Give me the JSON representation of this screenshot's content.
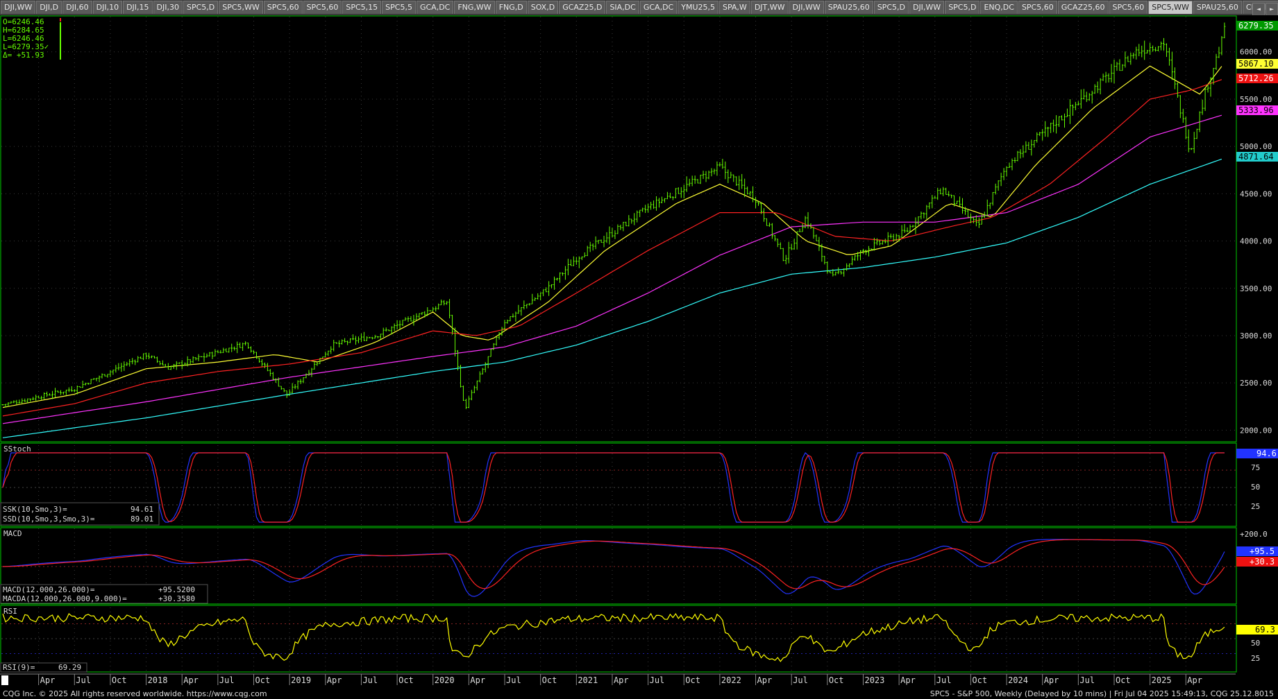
{
  "tabs": [
    {
      "label": "DJI,WW"
    },
    {
      "label": "DJI,D"
    },
    {
      "label": "DJI,60"
    },
    {
      "label": "DJI,10"
    },
    {
      "label": "DJI,15"
    },
    {
      "label": "DJI,30"
    },
    {
      "label": "SPC5,D"
    },
    {
      "label": "SPC5,WW"
    },
    {
      "label": "SPC5,60"
    },
    {
      "label": "SPC5,60"
    },
    {
      "label": "SPC5,15"
    },
    {
      "label": "SPC5,5"
    },
    {
      "label": "GCA,DC"
    },
    {
      "label": "FNG,WW"
    },
    {
      "label": "FNG,D"
    },
    {
      "label": "SOX,D"
    },
    {
      "label": "GCAZ25,D"
    },
    {
      "label": "SIA,DC"
    },
    {
      "label": "GCA,DC"
    },
    {
      "label": "YMU25,5"
    },
    {
      "label": "SPA,W"
    },
    {
      "label": "DJT,WW"
    },
    {
      "label": "DJI,WW"
    },
    {
      "label": "SPAU25,60"
    },
    {
      "label": "SPC5,D"
    },
    {
      "label": "DJI,WW"
    },
    {
      "label": "SPC5,D"
    },
    {
      "label": "ENQ,DC"
    },
    {
      "label": "SPC5,60"
    },
    {
      "label": "GCAZ25,60"
    },
    {
      "label": "SPC5,60"
    },
    {
      "label": "SPC5,WW",
      "active": true
    },
    {
      "label": "SPAU25,60"
    },
    {
      "label": "CNA,DC"
    },
    {
      "label": "+"
    }
  ],
  "nav": {
    "left": "◄",
    "right": "►"
  },
  "ohlc": {
    "open": "O=6246.46",
    "high": "H=6284.65",
    "low": "L=6246.46",
    "last": "L=6279.35✓",
    "delta": "Δ= +51.93"
  },
  "colors": {
    "bars": "#66ff00",
    "ma1": "#ffff33",
    "ma2": "#ff2222",
    "ma3": "#ff33ff",
    "ma4": "#33ffff",
    "k": "#2233ff",
    "d": "#ff2222",
    "rsi": "#ffff00",
    "grid": "#3a3a3a",
    "border": "#00cc00"
  },
  "price_axis": {
    "ticks": [
      "6000.00",
      "5500.00",
      "5000.00",
      "4500.00",
      "4000.00",
      "3500.00",
      "3000.00",
      "2500.00",
      "2000.00"
    ]
  },
  "badges": {
    "last": "6279.35",
    "ma1": "5867.10",
    "ma2": "5712.26",
    "ma3": "5333.96",
    "ma4": "4871.64"
  },
  "sstoch": {
    "title": "SStoch",
    "ssk_label": "SSK(10,Smo,3)=",
    "ssk_value": "94.61",
    "ssd_label": "SSD(10,Smo,3,Smo,3)=",
    "ssd_value": "89.01",
    "axis": [
      "75",
      "50",
      "25"
    ],
    "badge": "94.6"
  },
  "macd": {
    "title": "MACD",
    "macd_label": "MACD(12.000,26.000)=",
    "macd_value": "+95.5200",
    "macda_label": "MACDA(12.000,26.000,9.000)=",
    "macda_value": "+30.3580",
    "axis": [
      "+200.0"
    ],
    "badge1": "+95.5",
    "badge2": "+30.3"
  },
  "rsi": {
    "title": "RSI",
    "label": "RSI(9)=",
    "value": "69.29",
    "axis": [
      "50",
      "25"
    ],
    "badge": "69.3"
  },
  "time_axis": {
    "labels": [
      "Apr",
      "Jul",
      "Oct",
      "2018",
      "Apr",
      "Jul",
      "Oct",
      "2019",
      "Apr",
      "Jul",
      "Oct",
      "2020",
      "Apr",
      "Jul",
      "Oct",
      "2021",
      "Apr",
      "Jul",
      "Oct",
      "2022",
      "Apr",
      "Jul",
      "Oct",
      "2023",
      "Apr",
      "Jul",
      "Oct",
      "2024",
      "Apr",
      "Jul",
      "Oct",
      "2025",
      "Apr"
    ]
  },
  "footer": {
    "left": "CQG Inc. © 2025 All rights reserved worldwide. https://www.cqg.com",
    "right": "SPC5 - S&P 500, Weekly (Delayed by 10 mins) | Fri Jul 04 2025 15:49:13, CQG 25.12.8015"
  },
  "chart_data": {
    "type": "line",
    "title": "",
    "x_start": "2017-01-06",
    "x_end": "2025-07-04",
    "ylim": [
      1900,
      6350
    ],
    "series": [
      {
        "values": [
          [
            2017.0,
            2270
          ],
          [
            2017.5,
            2440
          ],
          [
            2018.0,
            2800
          ],
          [
            2018.15,
            2660
          ],
          [
            2018.7,
            2920
          ],
          [
            2018.98,
            2370
          ],
          [
            2019.3,
            2900
          ],
          [
            2019.6,
            3000
          ],
          [
            2020.1,
            3360
          ],
          [
            2020.22,
            2220
          ],
          [
            2020.5,
            3150
          ],
          [
            2020.8,
            3500
          ],
          [
            2021.0,
            3820
          ],
          [
            2021.5,
            4350
          ],
          [
            2022.0,
            4780
          ],
          [
            2022.25,
            4450
          ],
          [
            2022.45,
            3800
          ],
          [
            2022.6,
            4250
          ],
          [
            2022.78,
            3600
          ],
          [
            2023.0,
            3900
          ],
          [
            2023.3,
            4100
          ],
          [
            2023.55,
            4550
          ],
          [
            2023.8,
            4150
          ],
          [
            2024.0,
            4800
          ],
          [
            2024.3,
            5200
          ],
          [
            2024.6,
            5600
          ],
          [
            2024.9,
            6000
          ],
          [
            2025.1,
            6100
          ],
          [
            2025.28,
            4950
          ],
          [
            2025.4,
            5650
          ],
          [
            2025.5,
            6100
          ],
          [
            2025.51,
            6279.35
          ]
        ]
      },
      {
        "values": [
          [
            2017.0,
            2240
          ],
          [
            2017.5,
            2380
          ],
          [
            2018.0,
            2650
          ],
          [
            2018.5,
            2720
          ],
          [
            2018.9,
            2800
          ],
          [
            2019.2,
            2720
          ],
          [
            2019.6,
            2930
          ],
          [
            2020.0,
            3250
          ],
          [
            2020.2,
            3000
          ],
          [
            2020.4,
            2950
          ],
          [
            2020.8,
            3350
          ],
          [
            2021.2,
            3900
          ],
          [
            2021.7,
            4400
          ],
          [
            2022.0,
            4600
          ],
          [
            2022.3,
            4400
          ],
          [
            2022.6,
            4000
          ],
          [
            2022.9,
            3850
          ],
          [
            2023.2,
            3950
          ],
          [
            2023.6,
            4400
          ],
          [
            2023.9,
            4250
          ],
          [
            2024.2,
            4800
          ],
          [
            2024.6,
            5400
          ],
          [
            2025.0,
            5850
          ],
          [
            2025.35,
            5550
          ],
          [
            2025.51,
            5867.1
          ]
        ]
      },
      {
        "values": [
          [
            2017.0,
            2150
          ],
          [
            2017.5,
            2280
          ],
          [
            2018.0,
            2500
          ],
          [
            2018.5,
            2620
          ],
          [
            2019.0,
            2700
          ],
          [
            2019.5,
            2820
          ],
          [
            2020.0,
            3050
          ],
          [
            2020.3,
            3000
          ],
          [
            2020.6,
            3100
          ],
          [
            2021.0,
            3450
          ],
          [
            2021.5,
            3900
          ],
          [
            2022.0,
            4300
          ],
          [
            2022.4,
            4300
          ],
          [
            2022.8,
            4050
          ],
          [
            2023.2,
            4000
          ],
          [
            2023.6,
            4150
          ],
          [
            2023.9,
            4250
          ],
          [
            2024.3,
            4600
          ],
          [
            2024.7,
            5100
          ],
          [
            2025.0,
            5500
          ],
          [
            2025.3,
            5600
          ],
          [
            2025.51,
            5712.26
          ]
        ]
      },
      {
        "values": [
          [
            2017.0,
            2070
          ],
          [
            2018.0,
            2300
          ],
          [
            2019.0,
            2560
          ],
          [
            2020.0,
            2780
          ],
          [
            2020.5,
            2880
          ],
          [
            2021.0,
            3100
          ],
          [
            2021.5,
            3450
          ],
          [
            2022.0,
            3850
          ],
          [
            2022.5,
            4150
          ],
          [
            2023.0,
            4200
          ],
          [
            2023.5,
            4200
          ],
          [
            2024.0,
            4300
          ],
          [
            2024.5,
            4600
          ],
          [
            2025.0,
            5100
          ],
          [
            2025.51,
            5333.96
          ]
        ]
      },
      {
        "values": [
          [
            2017.0,
            1920
          ],
          [
            2018.0,
            2130
          ],
          [
            2019.0,
            2380
          ],
          [
            2020.0,
            2620
          ],
          [
            2020.5,
            2720
          ],
          [
            2021.0,
            2900
          ],
          [
            2021.5,
            3150
          ],
          [
            2022.0,
            3450
          ],
          [
            2022.5,
            3650
          ],
          [
            2023.0,
            3720
          ],
          [
            2023.5,
            3830
          ],
          [
            2024.0,
            3980
          ],
          [
            2024.5,
            4250
          ],
          [
            2025.0,
            4600
          ],
          [
            2025.51,
            4871.64
          ]
        ]
      }
    ]
  }
}
